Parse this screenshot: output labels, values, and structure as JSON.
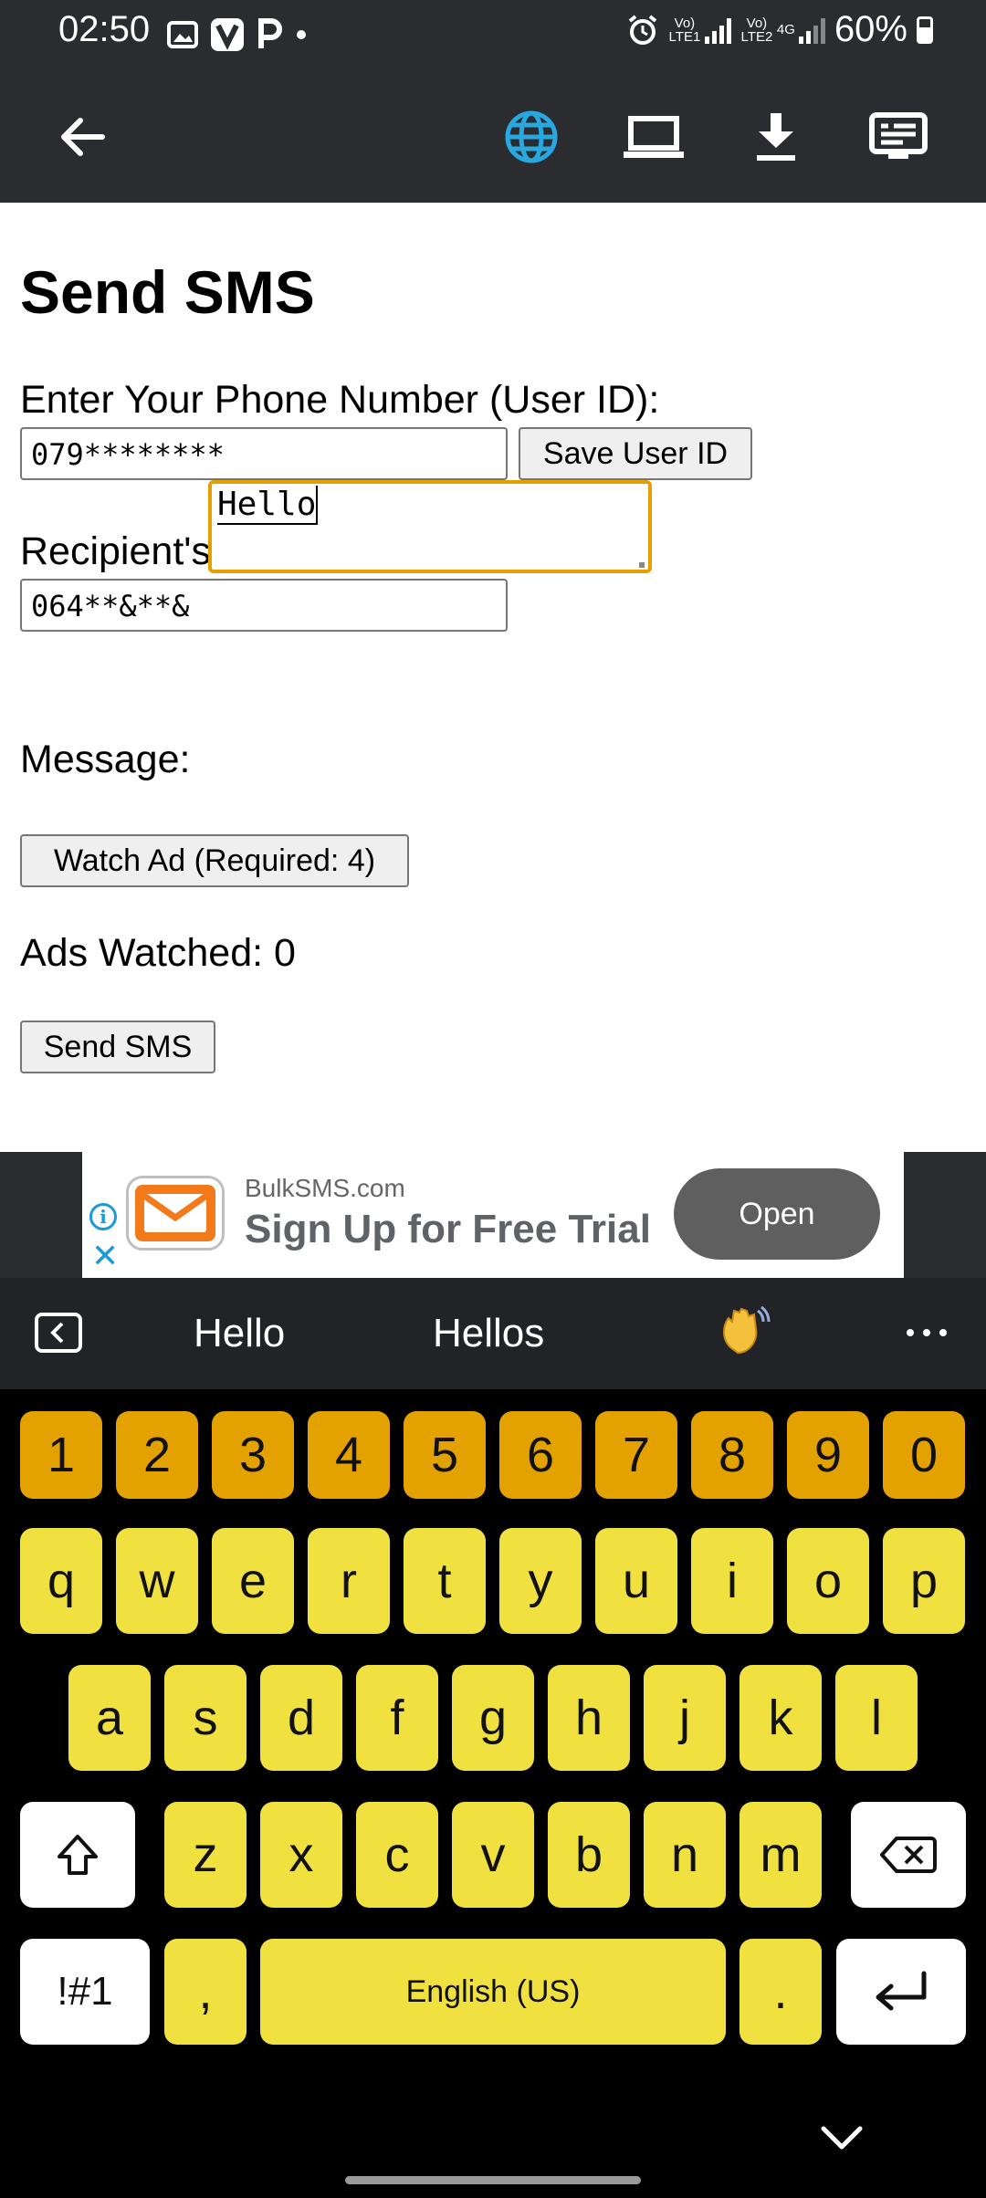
{
  "status_bar": {
    "time": "02:50",
    "network_1": "Vo) LTE1",
    "network_2": "Vo) LTE2",
    "network_type": "4G",
    "battery": "60%"
  },
  "toolbar": {
    "icons": [
      "back-arrow-icon",
      "globe-icon",
      "laptop-icon",
      "download-icon",
      "subtitles-icon"
    ],
    "active_color": "#29a8e0"
  },
  "page": {
    "title": "Send SMS",
    "user_id_label": "Enter Your Phone Number (User ID):",
    "user_id_value": "079********",
    "save_user_id_button": "Save User ID",
    "recipient_label": "Recipient's Phone Number:",
    "recipient_value": "064**&**&",
    "message_label": "Message:",
    "message_value": "Hello",
    "watch_ad_button": "Watch Ad (Required: 4)",
    "ads_watched": "Ads Watched: 0",
    "send_button": "Send SMS",
    "focus_color": "#e59f00"
  },
  "ad": {
    "domain": "BulkSMS.com",
    "headline": "Sign Up for Free Trial",
    "cta": "Open"
  },
  "keyboard": {
    "suggestions": [
      "Hello",
      "Hellos"
    ],
    "number_row": [
      "1",
      "2",
      "3",
      "4",
      "5",
      "6",
      "7",
      "8",
      "9",
      "0"
    ],
    "row1": [
      "q",
      "w",
      "e",
      "r",
      "t",
      "y",
      "u",
      "i",
      "o",
      "p"
    ],
    "row2": [
      "a",
      "s",
      "d",
      "f",
      "g",
      "h",
      "j",
      "k",
      "l"
    ],
    "row3": [
      "z",
      "x",
      "c",
      "v",
      "b",
      "n",
      "m"
    ],
    "symbols_key": "!#1",
    "comma_key": ",",
    "space_label": "English (US)",
    "period_key": ".",
    "key_color": "#f0e040",
    "number_key_color": "#e3a200"
  }
}
